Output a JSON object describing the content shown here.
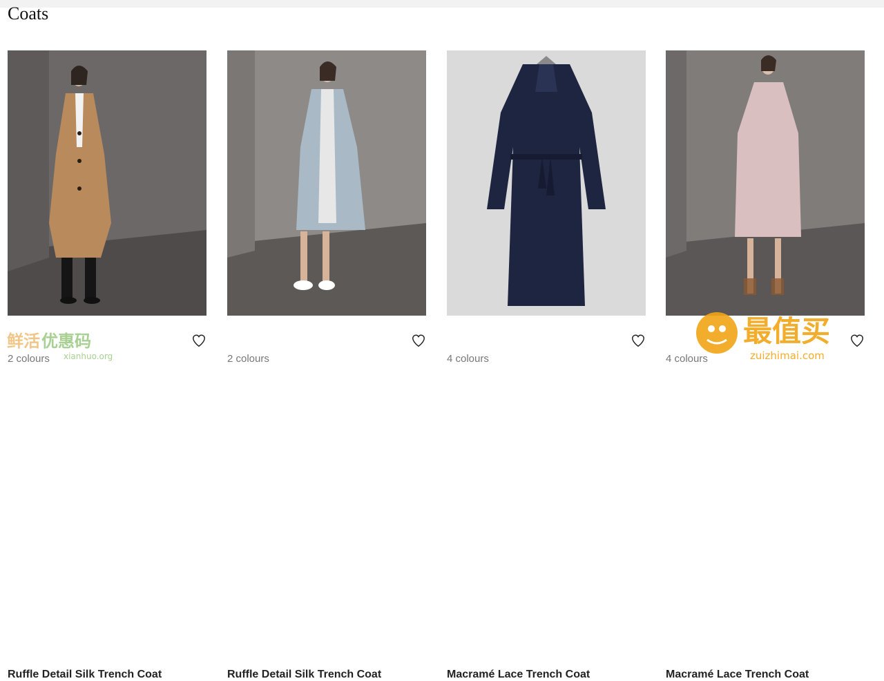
{
  "page": {
    "title": "Coats"
  },
  "products": [
    {
      "name": "Ruffle Detail Silk Trench Coat",
      "colours": "2 colours",
      "coat_color": "#b88a5c",
      "background": "#6e6b6a",
      "icon": "heart-outline-icon"
    },
    {
      "name": "Ruffle Detail Silk Trench Coat",
      "colours": "2 colours",
      "coat_color": "#a9bac6",
      "background": "#8a8785",
      "icon": "heart-outline-icon"
    },
    {
      "name": "Macramé Lace Trench Coat",
      "colours": "4 colours",
      "coat_color": "#1e2540",
      "background": "#d9d9d9",
      "icon": "heart-outline-icon"
    },
    {
      "name": "Macramé Lace Trench Coat",
      "colours": "4 colours",
      "coat_color": "#d9bfbf",
      "background": "#7d7a78",
      "icon": "heart-outline-icon"
    }
  ],
  "watermarks": {
    "left": {
      "text": "鲜活优惠码",
      "url": "xianhuo.org"
    },
    "right": {
      "text": "最值买",
      "url": "zuizhimai.com"
    }
  }
}
